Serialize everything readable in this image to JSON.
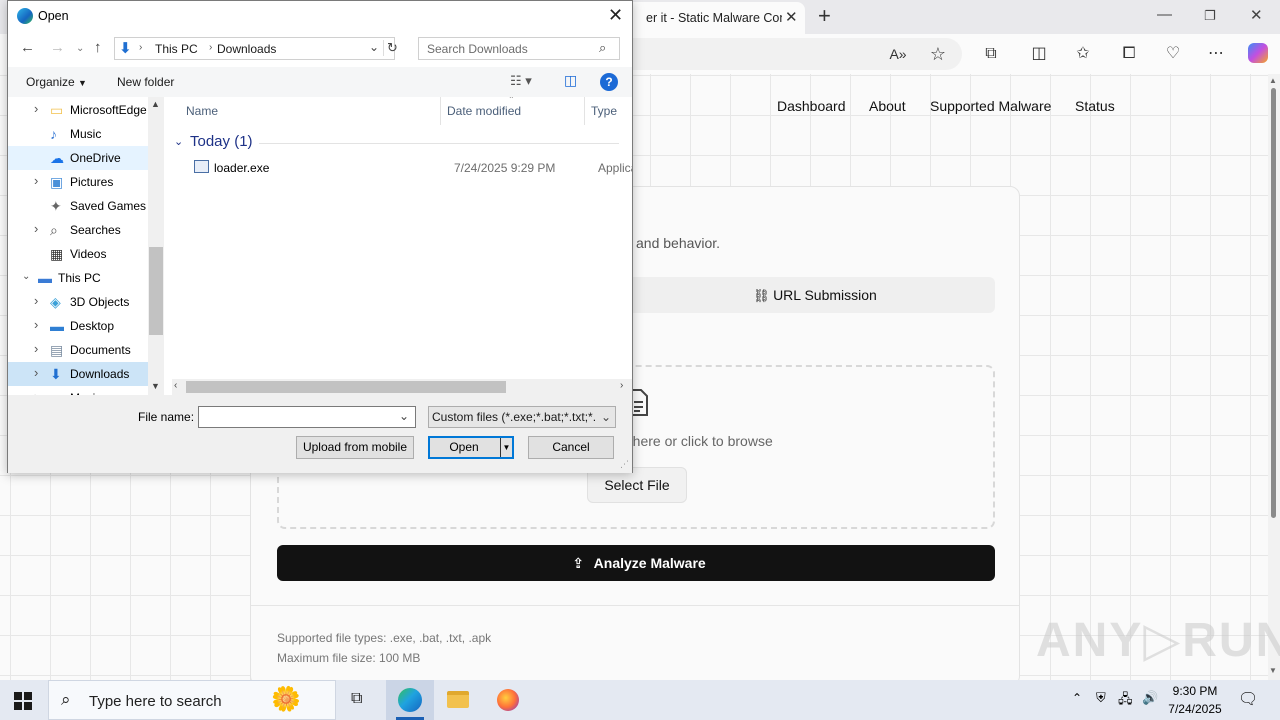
{
  "browser": {
    "tab_title": "er it - Static Malware Config",
    "toolbar_icons": [
      "read-aloud-icon",
      "favorite-star-icon",
      "extensions-icon",
      "split-screen-icon",
      "favorites-icon",
      "collections-icon",
      "browser-essentials-icon",
      "more-icon",
      "copilot-icon"
    ]
  },
  "site": {
    "nav": [
      "Dashboard",
      "About",
      "Supported Malware",
      "Status"
    ],
    "description_fragment": "and behavior.",
    "url_submission_tab": "URL Submission",
    "drop_text_fragment": "e here or click to browse",
    "select_file_label": "Select File",
    "analyze_label": "Analyze Malware",
    "supported_types": "Supported file types: .exe, .bat, .txt, .apk",
    "max_size": "Maximum file size: 100 MB"
  },
  "watermark": "ANY RUN",
  "dialog": {
    "title": "Open",
    "breadcrumb": [
      "This PC",
      "Downloads"
    ],
    "search_placeholder": "Search Downloads",
    "organize_label": "Organize",
    "new_folder_label": "New folder",
    "nav_items": [
      {
        "label": "MicrosoftEdge",
        "icon": "folder-icon",
        "expandable": true,
        "indent": 1,
        "state": ""
      },
      {
        "label": "Music",
        "icon": "music-icon",
        "expandable": false,
        "indent": 1,
        "state": ""
      },
      {
        "label": "OneDrive",
        "icon": "onedrive-icon",
        "expandable": false,
        "indent": 1,
        "state": "hover"
      },
      {
        "label": "Pictures",
        "icon": "pictures-icon",
        "expandable": true,
        "indent": 1,
        "state": ""
      },
      {
        "label": "Saved Games",
        "icon": "saved-games-icon",
        "expandable": false,
        "indent": 1,
        "state": ""
      },
      {
        "label": "Searches",
        "icon": "search-folder-icon",
        "expandable": true,
        "indent": 1,
        "state": ""
      },
      {
        "label": "Videos",
        "icon": "videos-icon",
        "expandable": false,
        "indent": 1,
        "state": ""
      },
      {
        "label": "This PC",
        "icon": "this-pc-icon",
        "expandable": true,
        "expanded": true,
        "indent": 0,
        "state": ""
      },
      {
        "label": "3D Objects",
        "icon": "3d-objects-icon",
        "expandable": true,
        "indent": 1,
        "state": ""
      },
      {
        "label": "Desktop",
        "icon": "desktop-icon",
        "expandable": true,
        "indent": 1,
        "state": ""
      },
      {
        "label": "Documents",
        "icon": "documents-icon",
        "expandable": true,
        "indent": 1,
        "state": ""
      },
      {
        "label": "Downloads",
        "icon": "downloads-icon",
        "expandable": true,
        "indent": 1,
        "state": "selected"
      },
      {
        "label": "Music",
        "icon": "music-icon",
        "expandable": true,
        "indent": 1,
        "state": ""
      }
    ],
    "columns": [
      "Name",
      "Date modified",
      "Type"
    ],
    "group_header": "Today (1)",
    "files": [
      {
        "name": "loader.exe",
        "date": "7/24/2025 9:29 PM",
        "type": "Applicat"
      }
    ],
    "file_name_label": "File name:",
    "file_name_value": "",
    "filter": "Custom files (*.exe;*.bat;*.txt;*.",
    "upload_mobile_label": "Upload from mobile",
    "open_label": "Open",
    "cancel_label": "Cancel"
  },
  "taskbar": {
    "search_placeholder": "Type here to search",
    "time": "9:30 PM",
    "date": "7/24/2025"
  }
}
